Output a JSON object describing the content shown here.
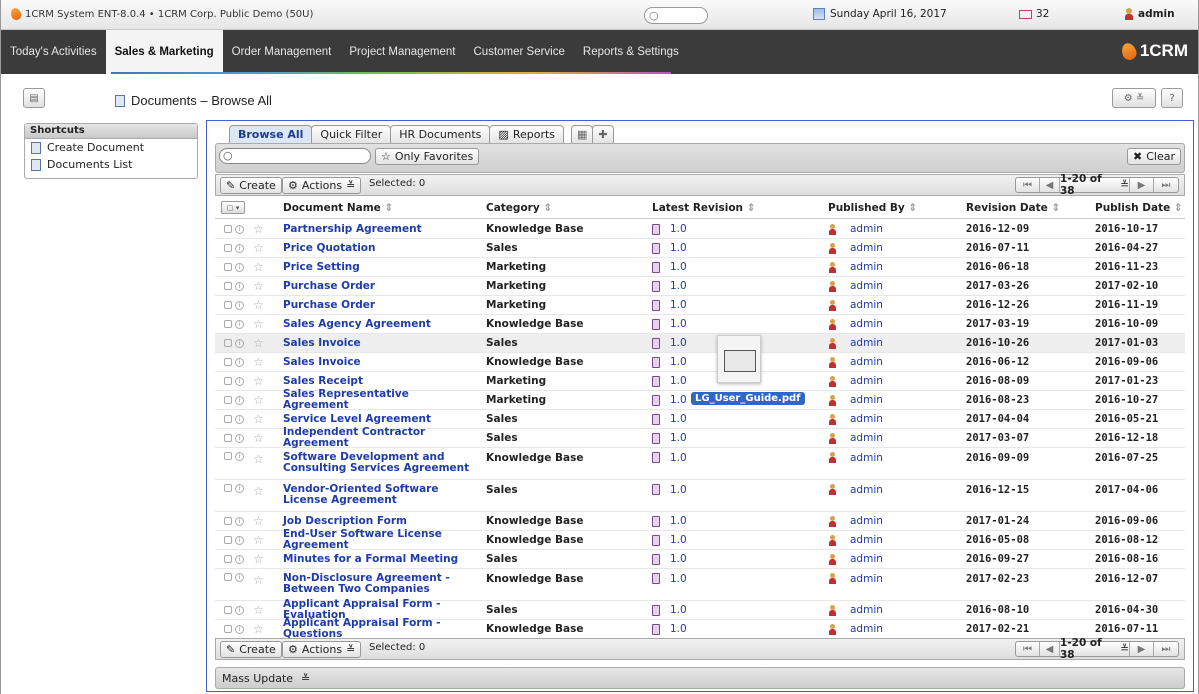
{
  "topbar": {
    "system": "1CRM System ENT-8.0.4 • 1CRM Corp. Public Demo (50U)",
    "date": "Sunday April 16, 2017",
    "mail_count": "32",
    "user": "admin"
  },
  "nav": {
    "tabs": [
      "Today's Activities",
      "Sales & Marketing",
      "Order Management",
      "Project Management",
      "Customer Service",
      "Reports & Settings"
    ],
    "active": "Sales & Marketing",
    "brand": "1CRM"
  },
  "page": {
    "title": "Documents – Browse All"
  },
  "sidebar": {
    "header": "Shortcuts",
    "items": [
      "Create Document",
      "Documents List"
    ]
  },
  "tabs": {
    "browse_all": "Browse All",
    "quick_filter": "Quick Filter",
    "hr_documents": "HR Documents",
    "reports": "Reports"
  },
  "filter": {
    "only_favorites": "Only Favorites",
    "clear": "Clear",
    "search_value": ""
  },
  "toolbar": {
    "create": "Create",
    "actions": "Actions",
    "selected": "Selected: 0",
    "range": "1-20 of 38"
  },
  "columns": {
    "name": "Document Name",
    "category": "Category",
    "revision": "Latest Revision",
    "published_by": "Published By",
    "revision_date": "Revision Date",
    "publish_date": "Publish Date"
  },
  "rows": [
    {
      "name": "Partnership Agreement",
      "category": "Knowledge Base",
      "revision": "1.0",
      "published_by": "admin",
      "revision_date": "2016-12-09",
      "publish_date": "2016-10-17"
    },
    {
      "name": "Price Quotation",
      "category": "Sales",
      "revision": "1.0",
      "published_by": "admin",
      "revision_date": "2016-07-11",
      "publish_date": "2016-04-27"
    },
    {
      "name": "Price Setting",
      "category": "Marketing",
      "revision": "1.0",
      "published_by": "admin",
      "revision_date": "2016-06-18",
      "publish_date": "2016-11-23"
    },
    {
      "name": "Purchase Order",
      "category": "Marketing",
      "revision": "1.0",
      "published_by": "admin",
      "revision_date": "2017-03-26",
      "publish_date": "2017-02-10"
    },
    {
      "name": "Purchase Order",
      "category": "Marketing",
      "revision": "1.0",
      "published_by": "admin",
      "revision_date": "2016-12-26",
      "publish_date": "2016-11-19"
    },
    {
      "name": "Sales Agency Agreement",
      "category": "Knowledge Base",
      "revision": "1.0",
      "published_by": "admin",
      "revision_date": "2017-03-19",
      "publish_date": "2016-10-09"
    },
    {
      "name": "Sales Invoice",
      "category": "Sales",
      "revision": "1.0",
      "published_by": "admin",
      "revision_date": "2016-10-26",
      "publish_date": "2017-01-03"
    },
    {
      "name": "Sales Invoice",
      "category": "Knowledge Base",
      "revision": "1.0",
      "published_by": "admin",
      "revision_date": "2016-06-12",
      "publish_date": "2016-09-06"
    },
    {
      "name": "Sales Receipt",
      "category": "Marketing",
      "revision": "1.0",
      "published_by": "admin",
      "revision_date": "2016-08-09",
      "publish_date": "2017-01-23"
    },
    {
      "name": "Sales Representative Agreement",
      "category": "Marketing",
      "revision": "1.0",
      "published_by": "admin",
      "revision_date": "2016-08-23",
      "publish_date": "2016-10-27"
    },
    {
      "name": "Service Level Agreement",
      "category": "Sales",
      "revision": "1.0",
      "published_by": "admin",
      "revision_date": "2017-04-04",
      "publish_date": "2016-05-21"
    },
    {
      "name": "Independent Contractor Agreement",
      "category": "Sales",
      "revision": "1.0",
      "published_by": "admin",
      "revision_date": "2017-03-07",
      "publish_date": "2016-12-18"
    },
    {
      "name": "Software Development and Consulting Services Agreement",
      "category": "Knowledge Base",
      "revision": "1.0",
      "published_by": "admin",
      "revision_date": "2016-09-09",
      "publish_date": "2016-07-25"
    },
    {
      "name": "Vendor-Oriented Software License Agreement",
      "category": "Sales",
      "revision": "1.0",
      "published_by": "admin",
      "revision_date": "2016-12-15",
      "publish_date": "2017-04-06"
    },
    {
      "name": "Job Description Form",
      "category": "Knowledge Base",
      "revision": "1.0",
      "published_by": "admin",
      "revision_date": "2017-01-24",
      "publish_date": "2016-09-06"
    },
    {
      "name": "End-User Software License Agreement",
      "category": "Knowledge Base",
      "revision": "1.0",
      "published_by": "admin",
      "revision_date": "2016-05-08",
      "publish_date": "2016-08-12"
    },
    {
      "name": "Minutes for a Formal Meeting",
      "category": "Sales",
      "revision": "1.0",
      "published_by": "admin",
      "revision_date": "2016-09-27",
      "publish_date": "2016-08-16"
    },
    {
      "name": "Non-Disclosure Agreement - Between Two Companies",
      "category": "Knowledge Base",
      "revision": "1.0",
      "published_by": "admin",
      "revision_date": "2017-02-23",
      "publish_date": "2016-12-07"
    },
    {
      "name": "Applicant Appraisal Form - Evaluation",
      "category": "Sales",
      "revision": "1.0",
      "published_by": "admin",
      "revision_date": "2016-08-10",
      "publish_date": "2016-04-30"
    },
    {
      "name": "Applicant Appraisal Form - Questions",
      "category": "Knowledge Base",
      "revision": "1.0",
      "published_by": "admin",
      "revision_date": "2017-02-21",
      "publish_date": "2016-07-11"
    }
  ],
  "drag_file": {
    "label": "LG_User_Guide.pdf"
  },
  "mass_update": "Mass Update"
}
